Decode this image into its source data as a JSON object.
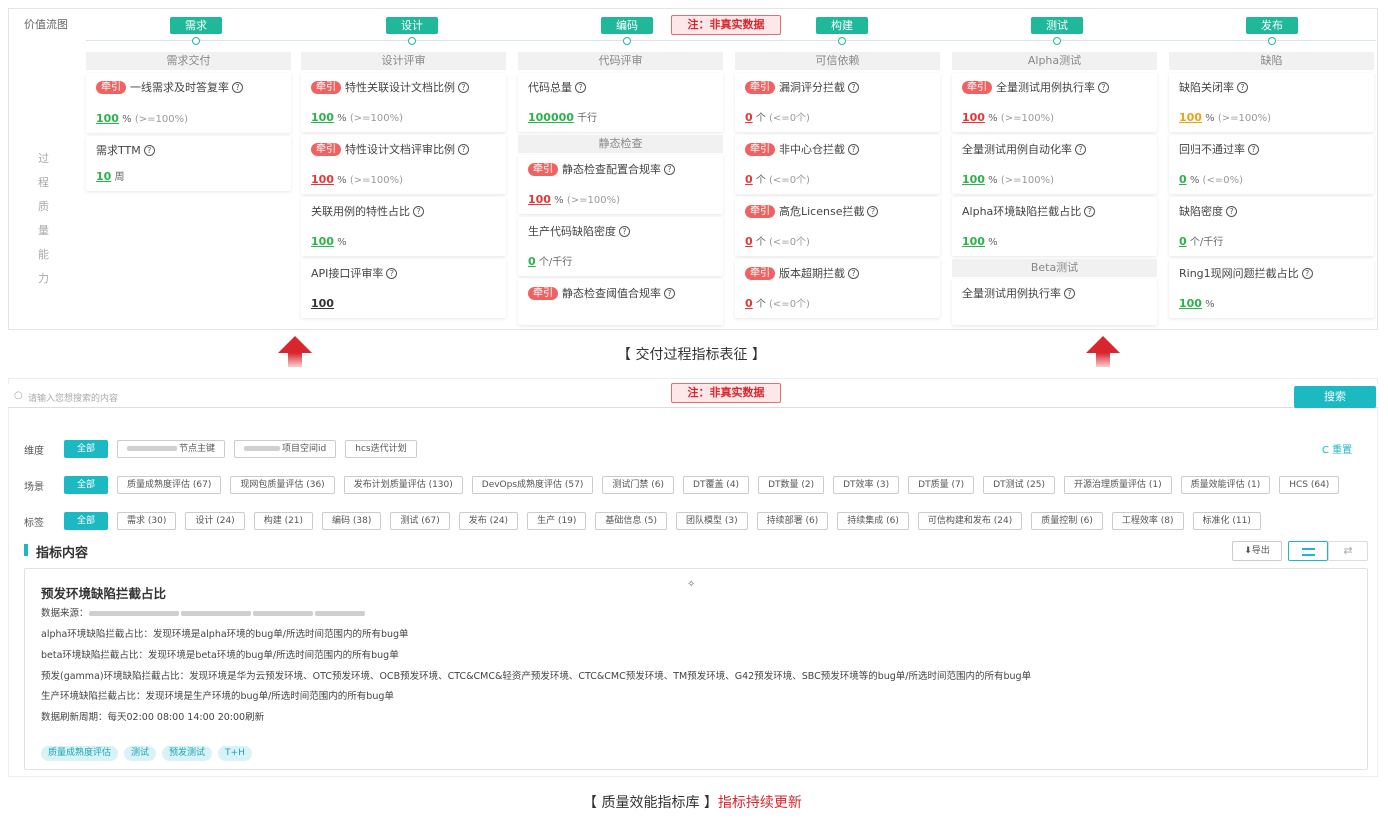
{
  "top": {
    "value_stream_label": "价值流图",
    "stages": [
      "需求",
      "设计",
      "编码",
      "构建",
      "测试",
      "发布"
    ],
    "note": "注：非真实数据",
    "side_label": [
      "过",
      "程",
      "质",
      "量",
      "能",
      "力"
    ],
    "columns": [
      {
        "head": "需求交付",
        "metrics": [
          {
            "tag": "牵引",
            "name": "一线需求及时答复率",
            "value": "100",
            "unit": "%",
            "target": "(>=100%)",
            "color": "g"
          },
          {
            "tag": "",
            "name": "需求TTM",
            "value": "10",
            "unit": "周",
            "target": "",
            "color": "g"
          }
        ]
      },
      {
        "head": "设计评审",
        "metrics": [
          {
            "tag": "牵引",
            "name": "特性关联设计文档比例",
            "value": "100",
            "unit": "%",
            "target": "(>=100%)",
            "color": "g"
          },
          {
            "tag": "牵引",
            "name": "特性设计文档评审比例",
            "value": "100",
            "unit": "%",
            "target": "(>=100%)",
            "color": "r"
          },
          {
            "tag": "",
            "name": "关联用例的特性占比",
            "value": "100",
            "unit": "%",
            "target": "",
            "color": "g"
          },
          {
            "tag": "",
            "name": "API接口评审率",
            "value": "100",
            "unit": "",
            "target": "",
            "color": "k"
          }
        ]
      },
      {
        "head": "代码评审",
        "metrics": [
          {
            "tag": "",
            "name": "代码总量",
            "value": "100000",
            "unit": "千行",
            "target": "",
            "color": "g"
          }
        ],
        "sub_head": "静态检查",
        "sub_metrics": [
          {
            "tag": "牵引",
            "name": "静态检查配置合规率",
            "value": "100",
            "unit": "%",
            "target": "(>=100%)",
            "color": "r"
          },
          {
            "tag": "",
            "name": "生产代码缺陷密度",
            "value": "0",
            "unit": "个/千行",
            "target": "",
            "color": "g"
          },
          {
            "tag": "牵引",
            "name": "静态检查阈值合规率",
            "value": "",
            "unit": "",
            "target": "",
            "color": "g"
          }
        ]
      },
      {
        "head": "可信依赖",
        "metrics": [
          {
            "tag": "牵引",
            "name": "漏洞评分拦截",
            "value": "0",
            "unit": "个",
            "target": "(<=0个)",
            "color": "r"
          },
          {
            "tag": "牵引",
            "name": "非中心仓拦截",
            "value": "0",
            "unit": "个",
            "target": "(<=0个)",
            "color": "r"
          },
          {
            "tag": "牵引",
            "name": "高危License拦截",
            "value": "0",
            "unit": "个",
            "target": "(<=0个)",
            "color": "r"
          },
          {
            "tag": "牵引",
            "name": "版本超期拦截",
            "value": "0",
            "unit": "个",
            "target": "(<=0个)",
            "color": "r"
          }
        ]
      },
      {
        "head": "Alpha测试",
        "metrics": [
          {
            "tag": "牵引",
            "name": "全量测试用例执行率",
            "value": "100",
            "unit": "%",
            "target": "(>=100%)",
            "color": "r"
          },
          {
            "tag": "",
            "name": "全量测试用例自动化率",
            "value": "100",
            "unit": "%",
            "target": "(>=100%)",
            "color": "g"
          },
          {
            "tag": "",
            "name": "Alpha环境缺陷拦截占比",
            "value": "100",
            "unit": "%",
            "target": "",
            "color": "g"
          }
        ],
        "sub_head": "Beta测试",
        "sub_metrics": [
          {
            "tag": "",
            "name": "全量测试用例执行率",
            "value": "",
            "unit": "",
            "target": "",
            "color": "g"
          }
        ]
      },
      {
        "head": "缺陷",
        "metrics": [
          {
            "tag": "",
            "name": "缺陷关闭率",
            "value": "100",
            "unit": "%",
            "target": "(>=100%)",
            "color": "o"
          },
          {
            "tag": "",
            "name": "回归不通过率",
            "value": "0",
            "unit": "%",
            "target": "(<=0%)",
            "color": "g"
          },
          {
            "tag": "",
            "name": "缺陷密度",
            "value": "0",
            "unit": "个/千行",
            "target": "",
            "color": "g"
          },
          {
            "tag": "",
            "name": "Ring1现网问题拦截占比",
            "value": "100",
            "unit": "%",
            "target": "",
            "color": "g"
          }
        ]
      }
    ],
    "caption": "【 交付过程指标表征 】"
  },
  "lower": {
    "search_placeholder": "请输入您想搜索的内容",
    "note": "注：非真实数据",
    "search_button": "搜索",
    "reset": "C 重置",
    "filters": [
      {
        "label": "维度",
        "chips": [
          "全部",
          "节点主键",
          "项目空间id",
          "hcs迭代计划"
        ]
      },
      {
        "label": "场景",
        "chips": [
          "全部",
          "质量成熟度评估 (67)",
          "现网包质量评估 (36)",
          "发布计划质量评估 (130)",
          "DevOps成熟度评估 (57)",
          "测试门禁 (6)",
          "DT覆盖 (4)",
          "DT数量 (2)",
          "DT效率 (3)",
          "DT质量 (7)",
          "DT测试 (25)",
          "开源治理质量评估 (1)",
          "质量效能评估 (1)",
          "HCS (64)"
        ]
      },
      {
        "label": "标签",
        "chips": [
          "全部",
          "需求 (30)",
          "设计 (24)",
          "构建 (21)",
          "编码 (38)",
          "测试 (67)",
          "发布 (24)",
          "生产 (19)",
          "基础信息 (5)",
          "团队模型 (3)",
          "持续部署 (6)",
          "持续集成 (6)",
          "可信构建和发布 (24)",
          "质量控制 (6)",
          "工程效率 (8)",
          "标准化 (11)"
        ]
      }
    ],
    "section_title": "指标内容",
    "export": "导出",
    "detail": {
      "title": "预发环境缺陷拦截占比",
      "source_label": "数据来源：",
      "lines": [
        "alpha环境缺陷拦截占比：发现环境是alpha环境的bug单/所选时间范围内的所有bug单",
        "beta环境缺陷拦截占比：发现环境是beta环境的bug单/所选时间范围内的所有bug单",
        "预发(gamma)环境缺陷拦截占比：发现环境是华为云预发环境、OTC预发环境、OCB预发环境、CTC&CMC&轻资产预发环境、CTC&CMC预发环境、TM预发环境、G42预发环境、SBC预发环境等的bug单/所选时间范围内的所有bug单",
        "生产环境缺陷拦截占比：发现环境是生产环境的bug单/所选时间范围内的所有bug单",
        "数据刷新周期：每天02:00 08:00 14:00 20:00刷新"
      ],
      "tags": [
        "质量成熟度评估",
        "测试",
        "预发测试",
        "T+H"
      ]
    },
    "caption_main": "【 质量效能指标库 】",
    "caption_red": "指标持续更新"
  }
}
